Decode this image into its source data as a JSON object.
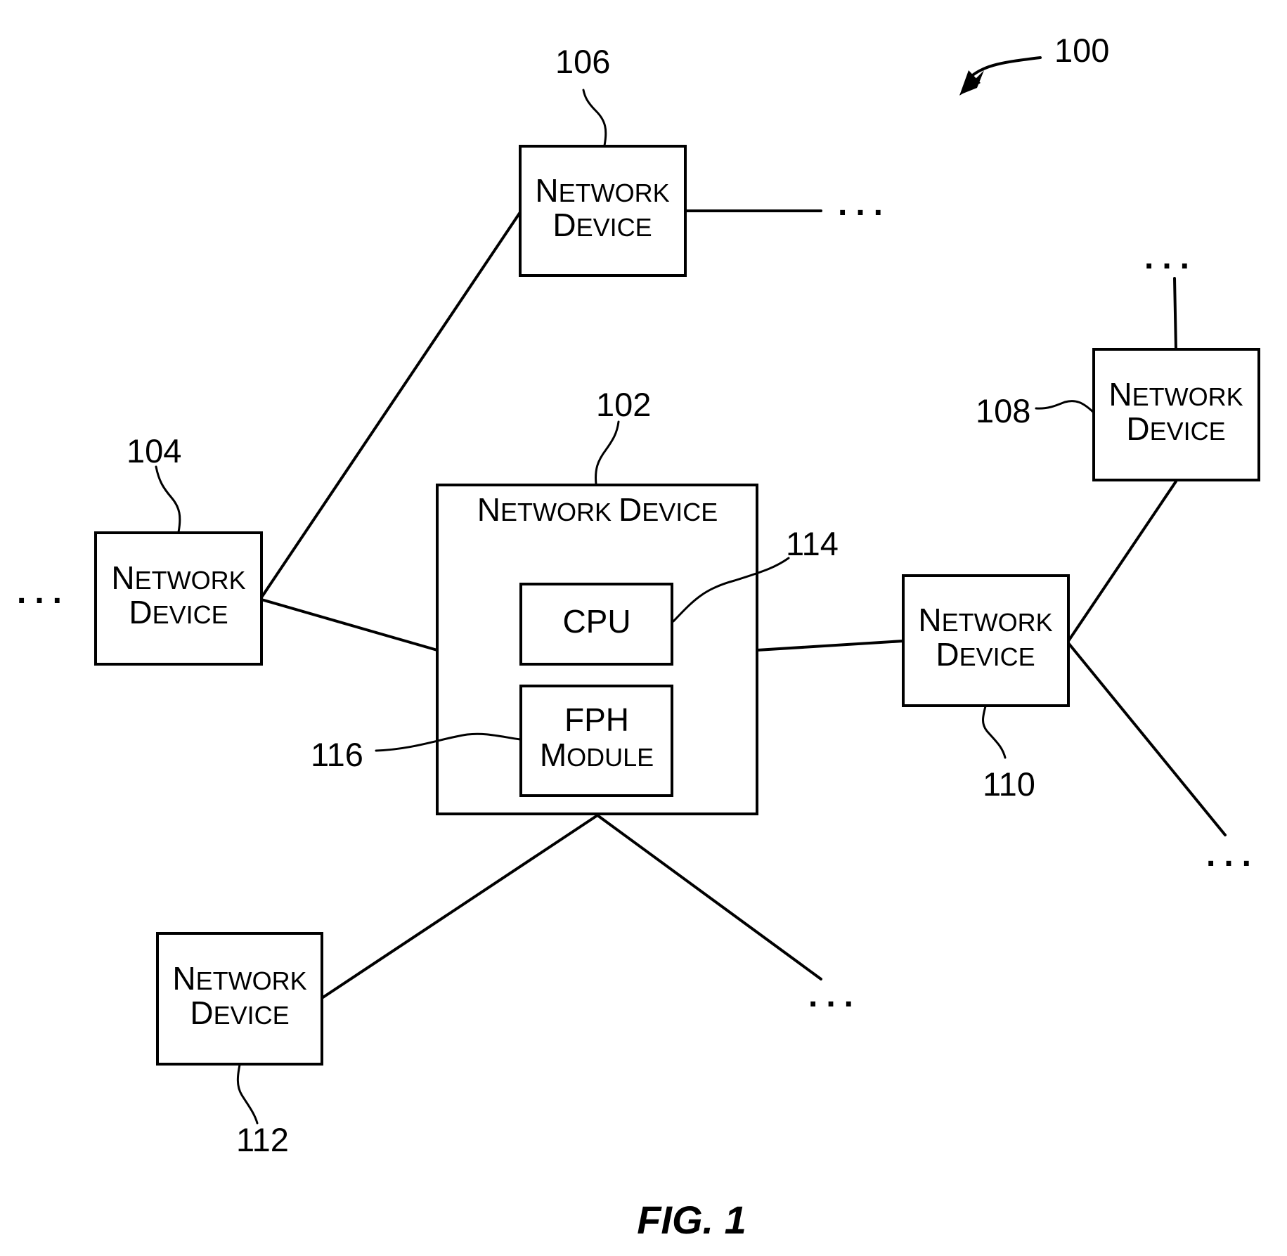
{
  "figure": {
    "title": "FIG. 1",
    "system_ref": "100",
    "ellipsis": "..."
  },
  "nodes": [
    {
      "id": "102",
      "ref": "102",
      "label_line1_cap": "N",
      "label_line1_rest": "ETWORK",
      "label_line2_cap": "D",
      "label_line2_rest": "EVICE",
      "label": "Network Device",
      "main": true
    },
    {
      "id": "104",
      "ref": "104",
      "label": "Network Device"
    },
    {
      "id": "106",
      "ref": "106",
      "label": "Network Device"
    },
    {
      "id": "108",
      "ref": "108",
      "label": "Network Device"
    },
    {
      "id": "110",
      "ref": "110",
      "label": "Network Device"
    },
    {
      "id": "112",
      "ref": "112",
      "label": "Network Device"
    }
  ],
  "components": [
    {
      "id": "114",
      "ref": "114",
      "label": "CPU"
    },
    {
      "id": "116",
      "ref": "116",
      "label_line1": "FPH",
      "label_line2": "Module"
    }
  ],
  "labels": {
    "network": "Network",
    "device": "Device",
    "network_device": "Network Device",
    "cpu": "CPU",
    "fph": "FPH",
    "module": "Module"
  },
  "connections": [
    {
      "from": "104",
      "to": "106"
    },
    {
      "from": "104",
      "to": "102"
    },
    {
      "from": "102",
      "to": "110"
    },
    {
      "from": "110",
      "to": "108"
    },
    {
      "from": "102",
      "to": "112"
    },
    {
      "from": "102",
      "to": "..."
    },
    {
      "from": "104",
      "to": "..."
    },
    {
      "from": "106",
      "to": "..."
    },
    {
      "from": "108",
      "to": "..."
    },
    {
      "from": "110",
      "to": "..."
    }
  ]
}
